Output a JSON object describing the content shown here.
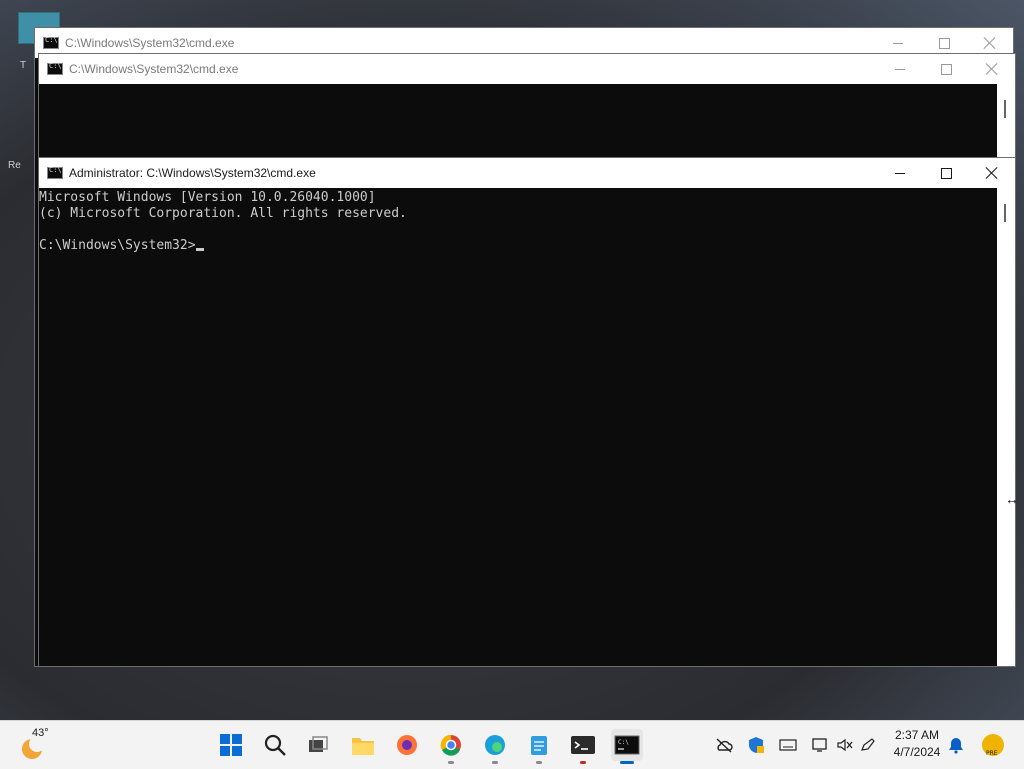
{
  "windows": {
    "back": {
      "title": "C:\\Windows\\System32\\cmd.exe"
    },
    "middle": {
      "title": "C:\\Windows\\System32\\cmd.exe"
    },
    "front": {
      "title": "Administrator: C:\\Windows\\System32\\cmd.exe",
      "console_lines": [
        "Microsoft Windows [Version 10.0.26040.1000]",
        "(c) Microsoft Corporation. All rights reserved.",
        "",
        "C:\\Windows\\System32>"
      ]
    }
  },
  "taskbar": {
    "weather_temp": "43°",
    "clock_time": "2:37 AM",
    "clock_date": "4/7/2024",
    "pinned": [
      "start-icon",
      "search-icon",
      "task-view-icon",
      "file-explorer-icon",
      "firefox-icon",
      "chrome-icon",
      "edge-icon",
      "notepad-icon",
      "terminal-icon",
      "cmd-icon"
    ],
    "tray": [
      "cloud-offline-icon",
      "defender-icon",
      "keyboard-icon",
      "network-icon",
      "volume-muted-icon",
      "pen-icon",
      "notification-bell-icon",
      "preview-badge-icon"
    ]
  }
}
